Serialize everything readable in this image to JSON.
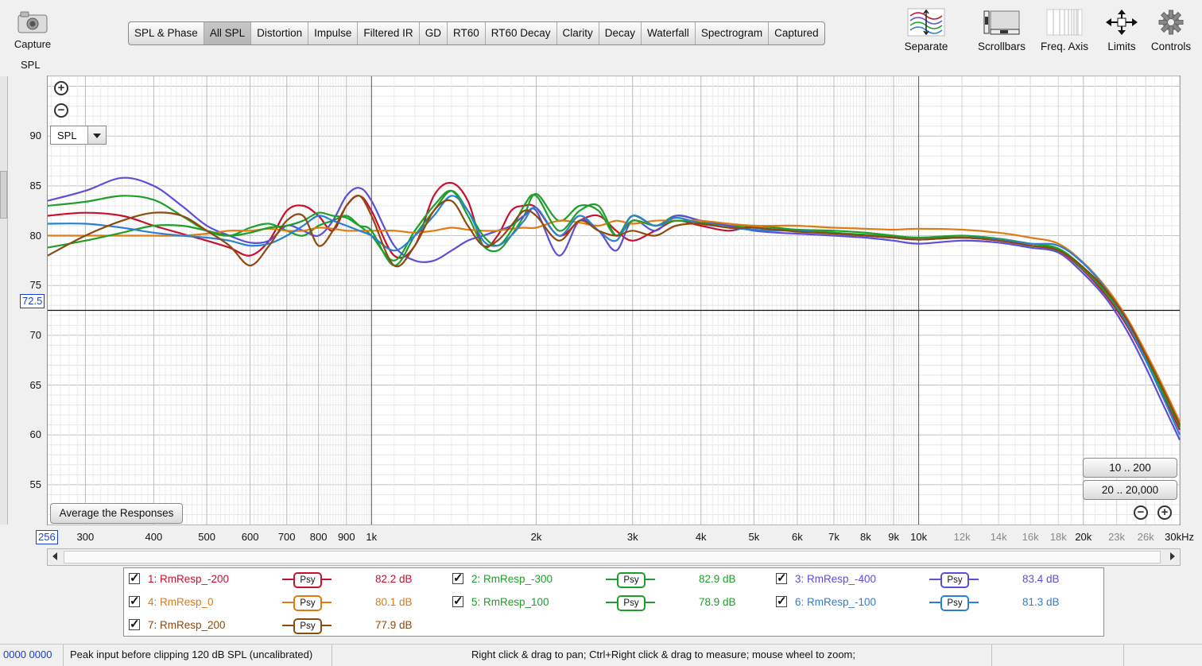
{
  "toolbar": {
    "capture": {
      "label": "Capture"
    },
    "section_label": "SPL",
    "tabs": [
      "SPL & Phase",
      "All SPL",
      "Distortion",
      "Impulse",
      "Filtered IR",
      "GD",
      "RT60",
      "RT60 Decay",
      "Clarity",
      "Decay",
      "Waterfall",
      "Spectrogram",
      "Captured"
    ],
    "active_tab": "All SPL",
    "tools": {
      "separate": "Separate",
      "scrollbars": "Scrollbars",
      "freq_axis": "Freq. Axis",
      "limits": "Limits",
      "controls": "Controls"
    }
  },
  "plot": {
    "dropdown_value": "SPL",
    "cursor_y_value": "72.5",
    "cursor_x_value": "256",
    "average_button": "Average the Responses",
    "range_buttons": [
      "10 .. 200",
      "20 .. 20,000"
    ]
  },
  "chart_data": {
    "type": "line",
    "title": "",
    "xlabel": "",
    "ylabel": "SPL",
    "x_scale": "log",
    "xlim": [
      256,
      30000
    ],
    "ylim": [
      51,
      96
    ],
    "grid": true,
    "y_ticks": [
      90,
      85,
      80,
      75,
      70,
      65,
      60,
      55
    ],
    "x_ticks": [
      {
        "label": "300",
        "major": true
      },
      {
        "label": "400",
        "major": true
      },
      {
        "label": "500",
        "major": true
      },
      {
        "label": "600",
        "major": true
      },
      {
        "label": "700",
        "major": true
      },
      {
        "label": "800",
        "major": true
      },
      {
        "label": "900",
        "major": true
      },
      {
        "label": "1k",
        "major": true
      },
      {
        "label": "2k",
        "major": true
      },
      {
        "label": "3k",
        "major": true
      },
      {
        "label": "4k",
        "major": true
      },
      {
        "label": "5k",
        "major": true
      },
      {
        "label": "6k",
        "major": true
      },
      {
        "label": "7k",
        "major": true
      },
      {
        "label": "8k",
        "major": true
      },
      {
        "label": "9k",
        "major": true
      },
      {
        "label": "10k",
        "major": true
      },
      {
        "label": "12k",
        "major": false
      },
      {
        "label": "14k",
        "major": false
      },
      {
        "label": "16k",
        "major": false
      },
      {
        "label": "18k",
        "major": false
      },
      {
        "label": "20k",
        "major": true
      },
      {
        "label": "23k",
        "major": false
      },
      {
        "label": "26k",
        "major": false
      },
      {
        "label": "30kHz",
        "major": true
      }
    ],
    "x_tick_values": [
      300,
      400,
      500,
      600,
      700,
      800,
      900,
      1000,
      2000,
      3000,
      4000,
      5000,
      6000,
      7000,
      8000,
      9000,
      10000,
      12000,
      14000,
      16000,
      18000,
      20000,
      23000,
      26000,
      30000
    ],
    "cursor_y": 72.5,
    "x": [
      256,
      300,
      350,
      400,
      450,
      500,
      550,
      600,
      650,
      700,
      750,
      800,
      850,
      900,
      950,
      1000,
      1100,
      1200,
      1300,
      1400,
      1500,
      1600,
      1700,
      1800,
      1900,
      2000,
      2200,
      2400,
      2600,
      2800,
      3000,
      3300,
      3600,
      4000,
      4500,
      5000,
      5500,
      6000,
      7000,
      8000,
      9000,
      10000,
      12000,
      14000,
      16000,
      18000,
      20000,
      22000,
      24000,
      26000,
      28000,
      30000
    ],
    "series": [
      {
        "name": "1: RmResp_-200",
        "color": "#c8102e",
        "avg": "82.2 dB",
        "values": [
          82.0,
          82.3,
          82.0,
          81.0,
          80.2,
          79.5,
          78.8,
          78.0,
          79.5,
          82.5,
          83.0,
          82.0,
          80.5,
          83.0,
          84.0,
          82.5,
          78.0,
          79.0,
          84.0,
          85.3,
          83.5,
          79.0,
          80.0,
          82.5,
          83.0,
          82.8,
          80.0,
          81.5,
          82.0,
          80.5,
          79.5,
          80.5,
          81.5,
          81.0,
          80.5,
          81.0,
          80.8,
          80.5,
          80.3,
          80.0,
          79.8,
          79.6,
          79.8,
          79.5,
          79.0,
          78.5,
          76.5,
          74.0,
          71.0,
          67.5,
          64.0,
          60.5
        ]
      },
      {
        "name": "2: RmResp_-300",
        "color": "#1f9e2a",
        "avg": "82.9 dB",
        "values": [
          83.0,
          83.4,
          84.0,
          83.6,
          82.0,
          80.5,
          80.0,
          80.8,
          81.2,
          80.5,
          80.0,
          81.0,
          81.5,
          82.0,
          81.0,
          80.0,
          77.5,
          80.5,
          83.0,
          84.5,
          82.0,
          79.0,
          78.5,
          80.0,
          82.0,
          84.2,
          81.5,
          83.0,
          82.5,
          80.0,
          82.0,
          81.0,
          82.0,
          81.5,
          81.0,
          81.0,
          80.8,
          80.6,
          80.5,
          80.3,
          80.0,
          79.8,
          80.0,
          79.7,
          79.2,
          78.7,
          76.8,
          74.3,
          71.3,
          67.8,
          64.3,
          61.0
        ]
      },
      {
        "name": "3: RmResp_-400",
        "color": "#5b4fd8",
        "avg": "83.4 dB",
        "values": [
          83.5,
          84.5,
          85.8,
          85.0,
          83.0,
          81.0,
          80.0,
          79.3,
          79.5,
          81.0,
          80.5,
          80.0,
          81.5,
          84.0,
          84.8,
          83.5,
          79.0,
          77.5,
          77.5,
          78.5,
          79.5,
          80.0,
          80.5,
          81.0,
          82.0,
          82.5,
          78.0,
          81.5,
          80.5,
          78.5,
          81.5,
          80.5,
          82.0,
          81.5,
          81.0,
          80.5,
          80.3,
          80.2,
          80.0,
          79.8,
          79.5,
          79.2,
          79.5,
          79.3,
          78.8,
          78.3,
          76.2,
          73.7,
          70.5,
          66.8,
          63.0,
          59.5
        ]
      },
      {
        "name": "4: RmResp_0",
        "color": "#e07b14",
        "avg": "80.1 dB",
        "values": [
          80.0,
          80.0,
          80.0,
          80.0,
          80.0,
          80.2,
          80.5,
          80.5,
          80.7,
          80.5,
          80.5,
          80.8,
          80.7,
          80.5,
          80.5,
          80.5,
          80.5,
          80.3,
          80.5,
          80.8,
          80.6,
          80.5,
          80.5,
          80.7,
          80.8,
          80.8,
          81.5,
          81.3,
          81.0,
          81.5,
          81.2,
          81.5,
          81.5,
          81.5,
          81.2,
          81.0,
          81.0,
          81.0,
          80.8,
          80.7,
          80.6,
          80.7,
          80.6,
          80.3,
          79.8,
          79.2,
          77.3,
          74.8,
          71.8,
          68.3,
          64.8,
          61.3
        ]
      },
      {
        "name": "5: RmResp_100",
        "color": "#1f9e2a",
        "avg": "78.9 dB",
        "values": [
          78.8,
          79.5,
          80.3,
          81.0,
          81.0,
          80.5,
          80.0,
          80.3,
          80.8,
          81.0,
          81.5,
          82.3,
          82.0,
          81.8,
          81.0,
          80.5,
          77.0,
          80.0,
          82.5,
          84.5,
          82.5,
          80.0,
          79.0,
          80.5,
          83.0,
          84.0,
          80.5,
          82.5,
          83.0,
          80.0,
          81.5,
          81.0,
          81.5,
          81.3,
          80.8,
          80.8,
          80.6,
          80.5,
          80.3,
          80.1,
          79.9,
          79.8,
          79.8,
          79.6,
          79.0,
          78.6,
          76.6,
          74.2,
          71.2,
          67.7,
          64.2,
          60.8
        ]
      },
      {
        "name": "6: RmResp_-100",
        "color": "#2c7fd1",
        "avg": "81.3 dB",
        "values": [
          81.2,
          81.2,
          80.8,
          80.3,
          80.0,
          79.8,
          79.5,
          79.0,
          79.2,
          80.0,
          81.0,
          82.0,
          81.5,
          81.0,
          80.5,
          80.0,
          78.5,
          80.0,
          82.0,
          84.0,
          82.5,
          79.5,
          79.0,
          80.0,
          81.5,
          82.8,
          80.0,
          82.0,
          80.5,
          79.5,
          82.0,
          81.0,
          81.8,
          81.2,
          80.8,
          80.6,
          80.5,
          80.5,
          80.2,
          80.0,
          79.8,
          79.6,
          79.8,
          79.6,
          79.2,
          79.0,
          77.2,
          74.6,
          71.3,
          67.5,
          63.7,
          60.0
        ]
      },
      {
        "name": "7: RmResp_200",
        "color": "#8c4a10",
        "avg": "77.9 dB",
        "values": [
          78.0,
          80.0,
          81.5,
          82.3,
          82.0,
          80.5,
          79.0,
          77.0,
          79.0,
          81.5,
          82.0,
          79.0,
          80.5,
          83.0,
          84.0,
          82.0,
          77.0,
          79.0,
          82.5,
          83.5,
          81.0,
          79.0,
          79.5,
          81.0,
          82.5,
          82.0,
          79.5,
          81.5,
          80.5,
          80.0,
          80.5,
          80.0,
          81.0,
          81.2,
          80.8,
          80.8,
          80.6,
          80.4,
          80.2,
          80.0,
          79.8,
          79.6,
          79.8,
          79.5,
          79.0,
          78.5,
          76.8,
          74.5,
          71.6,
          68.0,
          64.5,
          61.0
        ]
      }
    ]
  },
  "legend": {
    "tag": "Psy"
  },
  "statusbar": {
    "left_value": "0000 0000",
    "peak_message": "Peak input before clipping 120 dB SPL (uncalibrated)",
    "hint": "Right click & drag to pan; Ctrl+Right click & drag to measure; mouse wheel to zoom;"
  }
}
